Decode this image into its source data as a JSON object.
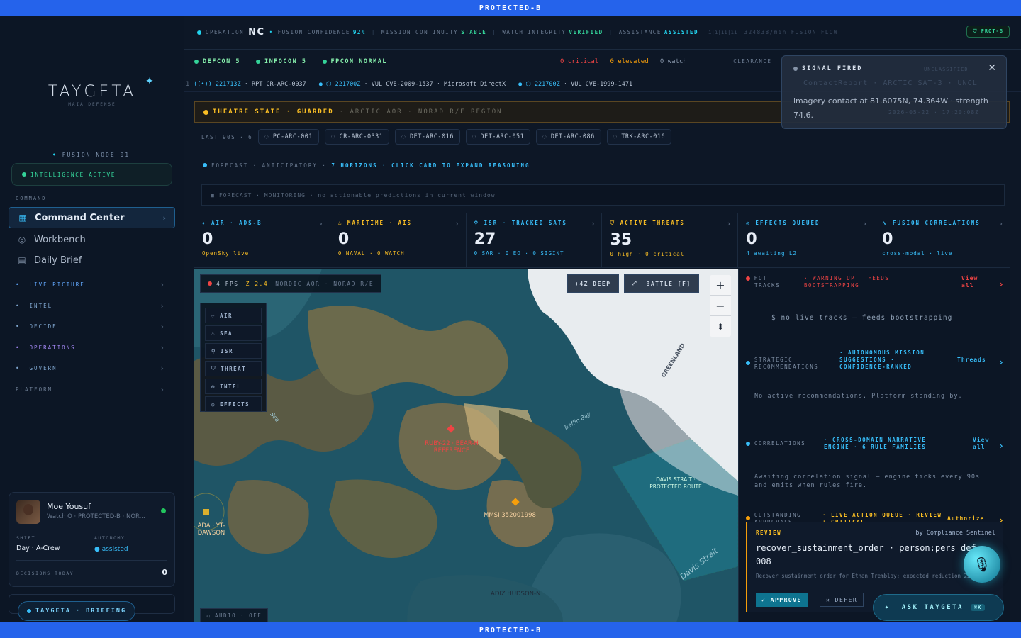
{
  "classification": {
    "top": "PROTECTED-B",
    "bottom": "PROTECTED-B"
  },
  "brand": {
    "name": "TAYGETA",
    "sub": "MAIA DEFENSE"
  },
  "sidebar": {
    "node_label": "FUSION NODE 01",
    "intel_status": "INTELLIGENCE ACTIVE",
    "command_label": "COMMAND",
    "nav": [
      {
        "label": "Command Center",
        "icon": "grid-icon"
      },
      {
        "label": "Workbench",
        "icon": "target-icon"
      },
      {
        "label": "Daily Brief",
        "icon": "document-icon"
      }
    ],
    "groups": [
      {
        "label": "LIVE PICTURE",
        "color": "#60a5fa"
      },
      {
        "label": "INTEL",
        "color": "#93c5fd"
      },
      {
        "label": "DECIDE",
        "color": "#93c5fd"
      },
      {
        "label": "OPERATIONS",
        "color": "#a78bfa"
      },
      {
        "label": "GOVERN",
        "color": "#93c5fd"
      },
      {
        "label": "PLATFORM",
        "color": "#6b7b91"
      }
    ],
    "user": {
      "name": "Moe Yousuf",
      "role": "Watch O · PROTECTED-B · NOR...",
      "shift_label": "SHIFT",
      "shift_value": "Day · A-Crew",
      "autonomy_label": "AUTONOMY",
      "autonomy_value": "assisted",
      "decisions_label": "DECISIONS TODAY",
      "decisions_value": "0"
    },
    "briefing_label": "TAYGETA · BRIEFING"
  },
  "topbar": {
    "operation_label": "OPERATION",
    "operation_value": "NC",
    "fusion_label": "FUSION CONFIDENCE",
    "fusion_value": "92%",
    "mission_label": "MISSION CONTINUITY",
    "mission_value": "STABLE",
    "watch_label": "WATCH INTEGRITY",
    "watch_value": "VERIFIED",
    "assist_label": "ASSISTANCE",
    "assist_value": "ASSISTED",
    "flow": "324838/min FUSION FLOW",
    "prot": "PROT-B"
  },
  "status": {
    "defcon": "DEFCON 5",
    "infocon": "INFOCON 5",
    "fpcon": "FPCON NORMAL",
    "critical": "0 critical",
    "elevated": "0 elevated",
    "watch": "0 watch",
    "clearance": "CLEARANCE"
  },
  "ticker": [
    {
      "time": "221713Z",
      "text": "RPT CR-ARC-0037"
    },
    {
      "time": "221700Z",
      "text": "VUL CVE-2009-1537 · Microsoft DirectX"
    },
    {
      "time": "221700Z",
      "text": "VUL CVE-1999-1471"
    }
  ],
  "theatre": {
    "state": "THEATRE STATE · GUARDED",
    "meta": "· ARCTIC AOR · NORAD R/E REGION"
  },
  "last90": {
    "label": "LAST 90S · 6",
    "chips": [
      "PC-ARC-001",
      "CR-ARC-0331",
      "DET-ARC-016",
      "DET-ARC-051",
      "DET-ARC-086",
      "TRK-ARC-016"
    ]
  },
  "forecast": {
    "label": "FORECAST · ANTICIPATORY ·",
    "action": "7 HORIZONS · CLICK CARD TO EXPAND REASONING",
    "empty": "FORECAST · MONITORING · no actionable predictions in current window"
  },
  "stats": [
    {
      "label": "AIR · ADS-B",
      "value": "0",
      "sub": "OpenSky live",
      "color": "#38bdf8",
      "icon": "plane-icon"
    },
    {
      "label": "MARITIME · AIS",
      "value": "0",
      "sub": "0 NAVAL · 0 WATCH",
      "color": "#fbbf24",
      "icon": "anchor-icon"
    },
    {
      "label": "ISR · TRACKED SATS",
      "value": "27",
      "sub": "0 SAR · 0 EO · 0 SIGINT",
      "color": "#38bdf8",
      "icon": "satellite-icon"
    },
    {
      "label": "ACTIVE THREATS",
      "value": "35",
      "sub": "0 high · 0 critical",
      "color": "#fbbf24",
      "icon": "shield-icon"
    },
    {
      "label": "EFFECTS QUEUED",
      "value": "0",
      "sub": "4 awaiting L2",
      "color": "#38bdf8",
      "icon": "target-icon"
    },
    {
      "label": "FUSION CORRELATIONS",
      "value": "0",
      "sub": "cross-modal · live",
      "color": "#38bdf8",
      "icon": "pulse-icon"
    }
  ],
  "map": {
    "fps": "4 FPS",
    "zoom": "Z 2.4",
    "region": "NORDIC AOR · NORAD R/E",
    "deep_btn": "+4Z DEEP",
    "battle_btn": "BATTLE [F]",
    "layers": [
      "AIR",
      "SEA",
      "ISR",
      "THREAT",
      "INTEL",
      "EFFECTS"
    ],
    "audio": "AUDIO · OFF",
    "labels": {
      "greenland": "GREENLAND",
      "baffin": "Baffin Bay",
      "davis": "Davis Strait",
      "sea": "Sea",
      "davis_route": "DAVIS STRAIT · PROTECTED ROUTE",
      "adiz": "ADIZ HUDSON-N",
      "track1": "RUBY-22 · BEAR-H REFERENCE",
      "track2": "MMSI 352001998",
      "track3": "ADA · YT-DAWSON"
    }
  },
  "right": {
    "hot": {
      "label": "HOT TRACKS",
      "alert": "· WARNING UP · FEEDS BOOTSTRAPPING",
      "link": "View all",
      "body": "$ no live tracks — feeds bootstrapping"
    },
    "strat": {
      "label": "STRATEGIC RECOMMENDATIONS",
      "mid": "· AUTONOMOUS MISSION SUGGESTIONS · CONFIDENCE-RANKED",
      "link": "Threads",
      "body": "No active recommendations. Platform standing by."
    },
    "corr": {
      "label": "CORRELATIONS",
      "mid": "· CROSS-DOMAIN NARRATIVE ENGINE · 6 RULE FAMILIES",
      "link": "View all",
      "body": "Awaiting correlation signal — engine ticks every 90s and emits when rules fire."
    },
    "appr": {
      "label": "OUTSTANDING APPROVALS",
      "mid": "· LIVE ACTION QUEUE · REVIEW + CRITICAL",
      "link": "Authorize"
    },
    "review": {
      "tag": "REVIEW",
      "by": "by Compliance Sentinel",
      "title": "recover_sustainment_order · person:pers def-008",
      "desc": "Recover sustainment order for Ethan Tremblay; expected reduction 22%.",
      "approve": "APPROVE",
      "defer": "DEFER"
    }
  },
  "toast": {
    "title": "SIGNAL FIRED",
    "body": "imagery contact at 81.6075N, 74.364W · strength 74.6.",
    "ghost1": "ContactReport · ARCTIC SAT-3 · UNCL",
    "ghost2": "UNCLASSIFIED",
    "ghost3": "2026-05-22 · 17:20:08Z"
  },
  "ask": {
    "label": "ASK TAYGETA",
    "kbd": "⌘K"
  }
}
